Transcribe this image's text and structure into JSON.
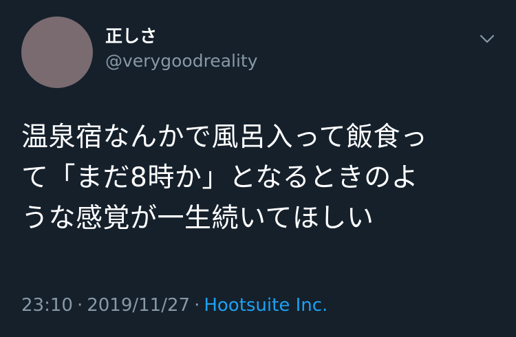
{
  "tweet": {
    "author": {
      "display_name": "正しさ",
      "handle": "@verygoodreality",
      "avatar_color": "#7a6b70"
    },
    "menu_icon": "chevron-down-icon",
    "text_lines": [
      "温泉宿なんかで風呂入って飯食っ",
      "て「まだ8時か」となるときのよ",
      "うな感覚が一生続いてほしい"
    ],
    "time": "23:10",
    "separator": "·",
    "date": "2019/11/27",
    "source": "Hootsuite Inc."
  },
  "colors": {
    "background": "#15202b",
    "primary_text": "#ffffff",
    "secondary_text": "#8899a6",
    "link": "#1da1f2"
  }
}
